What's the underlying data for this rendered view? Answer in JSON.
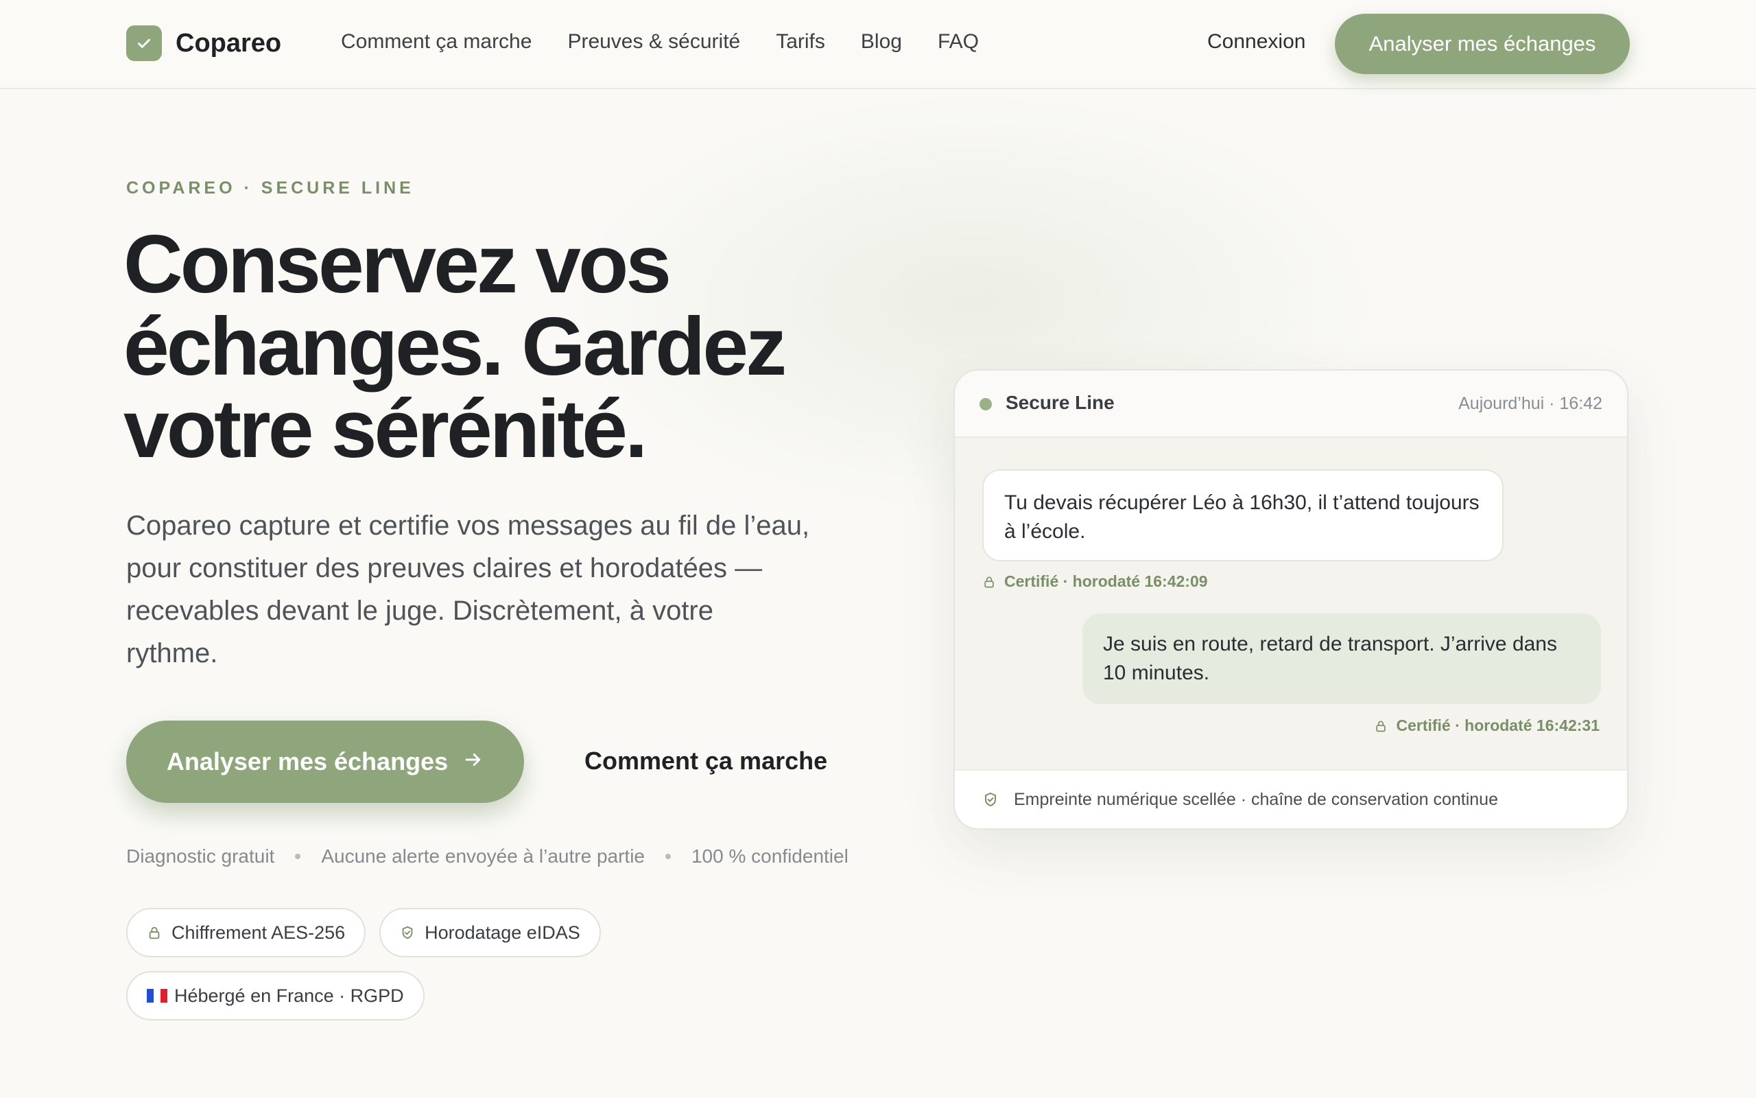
{
  "brand": {
    "name": "Copareo",
    "accent": "#8fa57b",
    "text_dark": "#1f2125"
  },
  "nav": {
    "links": [
      "Comment ça marche",
      "Preuves & sécurité",
      "Tarifs",
      "Blog",
      "FAQ"
    ],
    "login": "Connexion",
    "cta": "Analyser mes échanges"
  },
  "hero": {
    "eyebrow": "COPAREO · SECURE LINE",
    "headline": [
      "Conservez vos",
      "échanges. Gardez",
      "votre sérénité."
    ],
    "lead": "Copareo capture et certifie vos messages au fil de l’eau, pour constituer des preuves claires et horodatées — recevables devant le juge. Discrètement, à votre rythme.",
    "cta_primary": "Analyser mes échanges",
    "cta_primary_icon": "arrow-right-icon",
    "cta_secondary": "Comment ça marche",
    "assurances": [
      "Diagnostic gratuit",
      "Aucune alerte envoyée à l’autre partie",
      "100 % confidentiel"
    ],
    "badges": [
      {
        "icon": "lock-icon",
        "label": "Chiffrement AES-256"
      },
      {
        "icon": "shield-check-icon",
        "label": "Horodatage eIDAS"
      },
      {
        "icon": "france-flag-icon",
        "label": "Hébergé en France · RGPD"
      }
    ]
  },
  "chat_card": {
    "title": "Secure Line",
    "timestamp": "Aujourd’hui · 16:42",
    "messages": [
      {
        "direction": "incoming",
        "text": "Tu devais récupérer Léo à 16h30, il t’attend toujours à l’école.",
        "stamp": "Certifié · horodaté 16:42:09"
      },
      {
        "direction": "outgoing",
        "text": "Je suis en route, retard de transport. J’arrive dans 10 minutes.",
        "stamp": "Certifié · horodaté 16:42:31"
      }
    ],
    "footer": "Empreinte numérique scellée · chaîne de conservation continue"
  }
}
